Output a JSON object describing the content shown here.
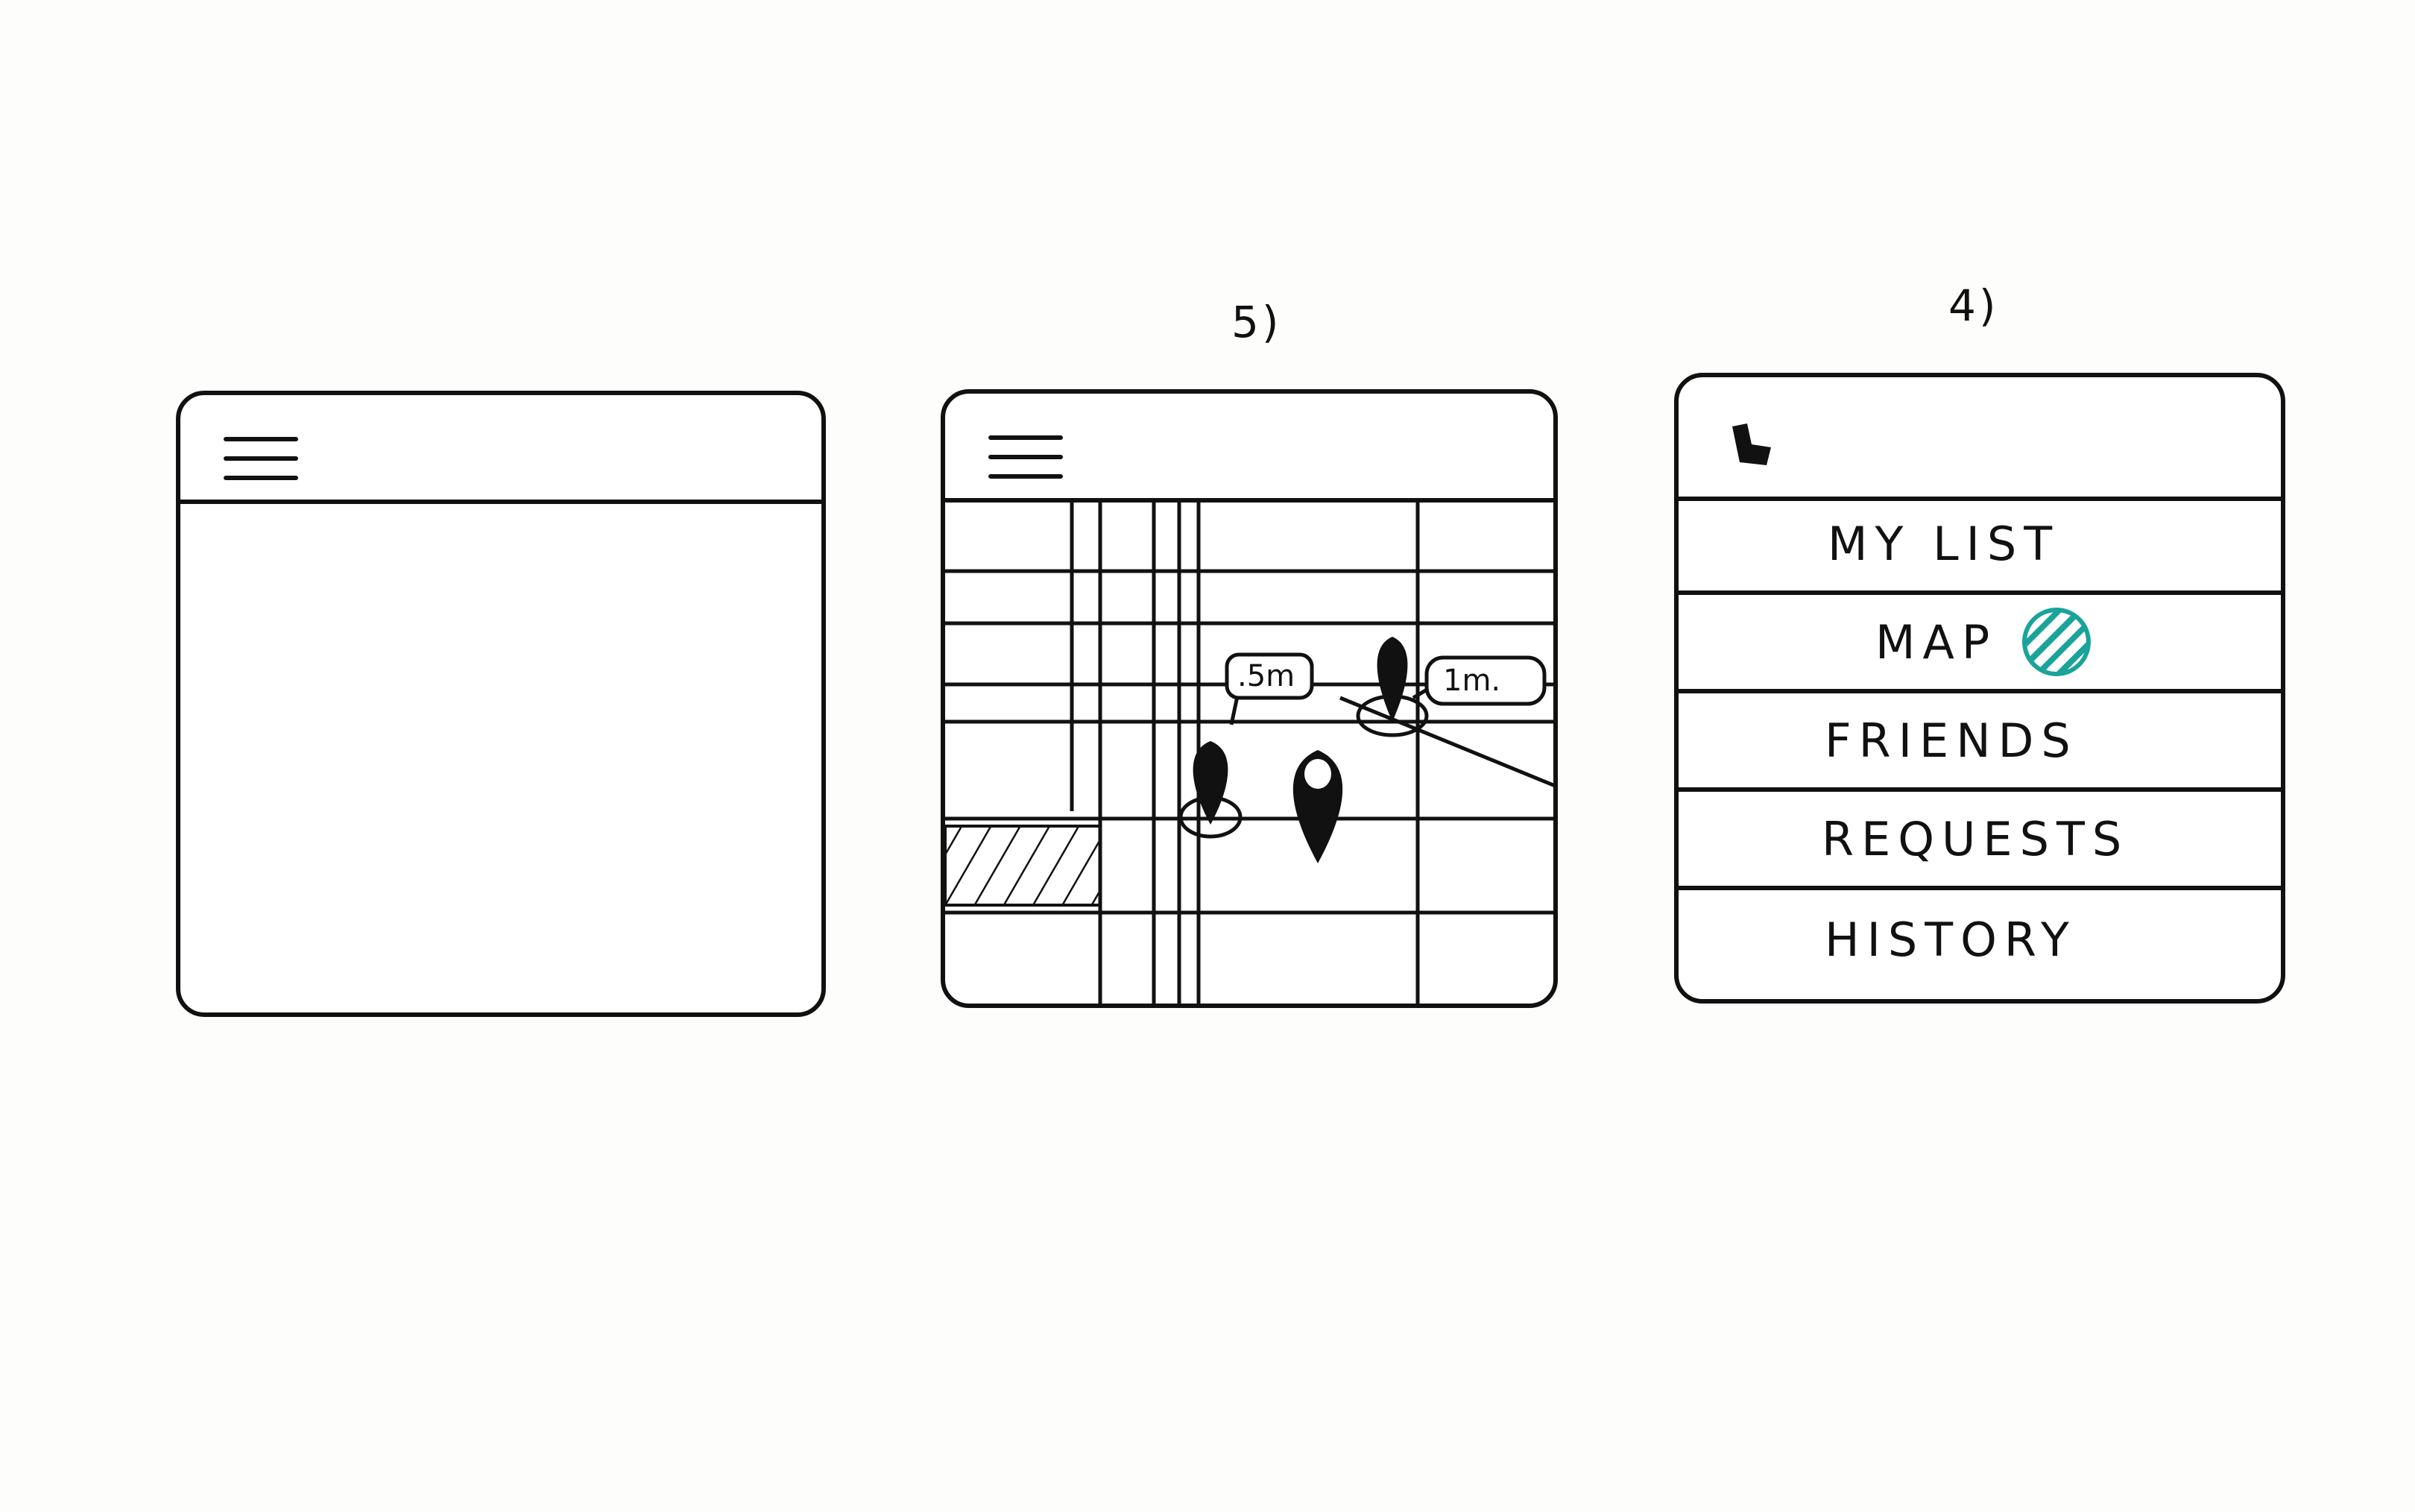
{
  "labels": {
    "frame2": "5)",
    "frame3": "4)"
  },
  "screen1": {
    "menu_icon": "hamburger-icon"
  },
  "screen2": {
    "menu_icon": "hamburger-icon",
    "markers": [
      {
        "icon": "map-pin-icon",
        "distance": ".5m"
      },
      {
        "icon": "map-pin-icon",
        "distance": "1m."
      },
      {
        "icon": "map-pin-icon",
        "distance": ""
      },
      {
        "icon": "map-pin-icon",
        "distance": ""
      }
    ]
  },
  "screen3": {
    "back_icon": "back-arrow-icon",
    "menu": {
      "items": [
        {
          "label": "MY LIST"
        },
        {
          "label": "MAP",
          "indicator_color": "#1aa39a"
        },
        {
          "label": "FRIENDS"
        },
        {
          "label": "REQUESTS"
        },
        {
          "label": "HISTORY"
        }
      ]
    }
  }
}
